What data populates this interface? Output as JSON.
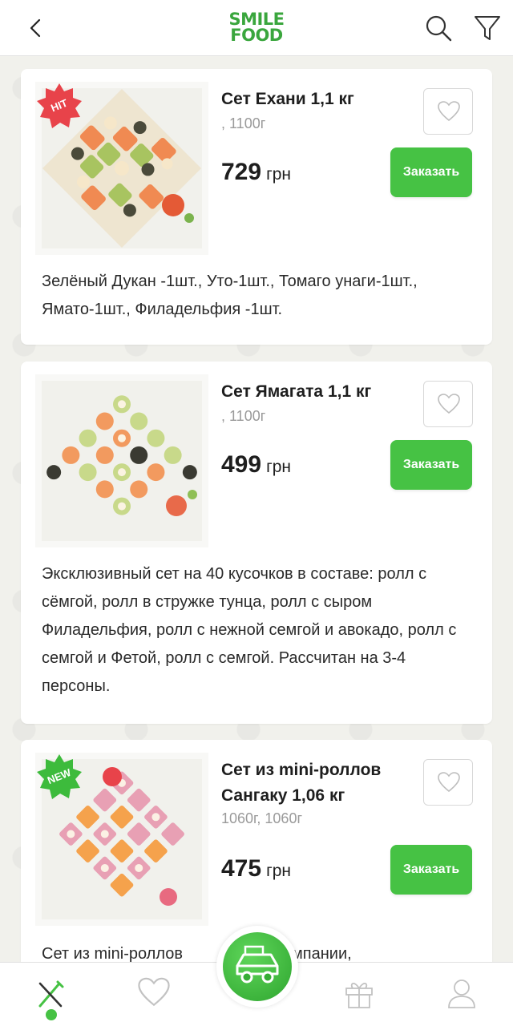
{
  "header": {
    "logo_line1": "SMILE",
    "logo_line2": "FOOD",
    "brand_color": "#3aa63d"
  },
  "products": [
    {
      "badge": "HIT",
      "badge_color": "#e8434a",
      "title": "Сет Ехани 1,1 кг",
      "weight": ", 1100г",
      "price": "729",
      "currency": "грн",
      "order_label": "Заказать",
      "desc": "Зелёный Дукан -1шт., Уто-1шт., Томаго унаги-1шт., Ямато-1шт., Филадельфия -1шт."
    },
    {
      "badge": "",
      "title": "Сет Ямагата 1,1 кг",
      "weight": ", 1100г",
      "price": "499",
      "currency": "грн",
      "order_label": "Заказать",
      "desc": "Эксклюзивный сет на 40 кусочков в составе: ролл с сёмгой, ролл в стружке тунца, ролл с сыром Филадельфия, ролл с нежной семгой и авокадо, ролл с семгой и Фетой, ролл с семгой. Рассчитан на 3-4 персоны."
    },
    {
      "badge": "NEW",
      "badge_color": "#3dbb3c",
      "title": "Сет из mini-роллов Сангаку 1,06 кг",
      "weight": "1060г, 1060г",
      "price": "475",
      "currency": "грн",
      "order_label": "Заказать",
      "desc": "Сет из mini-роллов         льшой компании,"
    }
  ],
  "bottom_nav": {
    "items": [
      "menu-icon",
      "heart-icon",
      "delivery-car-icon",
      "gift-icon",
      "user-icon"
    ],
    "active_color": "#46c244"
  }
}
